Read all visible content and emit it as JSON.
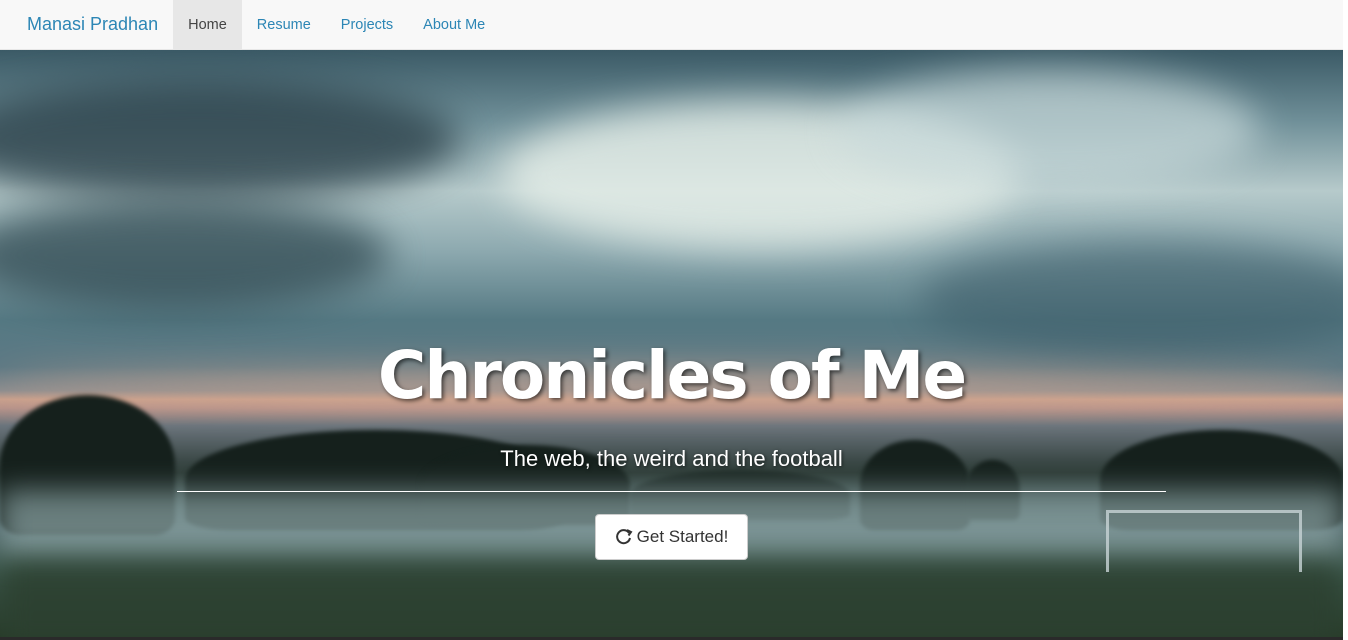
{
  "navbar": {
    "brand": "Manasi Pradhan",
    "items": [
      {
        "label": "Home",
        "active": true
      },
      {
        "label": "Resume",
        "active": false
      },
      {
        "label": "Projects",
        "active": false
      },
      {
        "label": "About Me",
        "active": false
      }
    ]
  },
  "hero": {
    "title": "Chronicles of Me",
    "subtitle": "The web, the weird and the football",
    "button_label": "Get Started!",
    "button_icon": "refresh-icon"
  },
  "colors": {
    "brand": "#2c86b5",
    "navbar_bg": "#f8f8f8",
    "active_nav_bg": "#e7e7e7"
  }
}
